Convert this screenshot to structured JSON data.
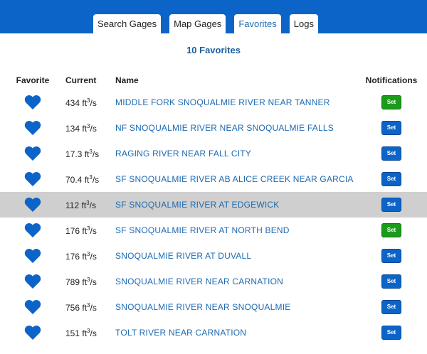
{
  "tabs": [
    {
      "label": "Search Gages"
    },
    {
      "label": "Map Gages"
    },
    {
      "label": "Favorites"
    },
    {
      "label": "Logs"
    }
  ],
  "active_tab": "Favorites",
  "favorites_count": "10 Favorites",
  "columns": {
    "favorite": "Favorite",
    "current": "Current",
    "name": "Name",
    "notifications": "Notifications"
  },
  "unit": {
    "base": "ft",
    "exp": "3",
    "suffix": "/s"
  },
  "colors": {
    "accent": "#0d64c8",
    "link": "#1d6ab2",
    "heart": "#0d64c8",
    "set_blue": "#0d64c8",
    "set_green": "#1c9a1c",
    "highlight_row": "#cfcfcf"
  },
  "rows": [
    {
      "flow": "434",
      "name": "MIDDLE FORK SNOQUALMIE RIVER NEAR TANNER",
      "set": "Set",
      "set_color": "green",
      "highlighted": false
    },
    {
      "flow": "134",
      "name": "NF SNOQUALMIE RIVER NEAR SNOQUALMIE FALLS",
      "set": "Set",
      "set_color": "blue",
      "highlighted": false
    },
    {
      "flow": "17.3",
      "name": "RAGING RIVER NEAR FALL CITY",
      "set": "Set",
      "set_color": "blue",
      "highlighted": false
    },
    {
      "flow": "70.4",
      "name": "SF SNOQUALMIE RIVER AB ALICE CREEK NEAR GARCIA",
      "set": "Set",
      "set_color": "blue",
      "highlighted": false
    },
    {
      "flow": "112",
      "name": "SF SNOQUALMIE RIVER AT EDGEWICK",
      "set": "Set",
      "set_color": "blue",
      "highlighted": true
    },
    {
      "flow": "176",
      "name": "SF SNOQUALMIE RIVER AT NORTH BEND",
      "set": "Set",
      "set_color": "green",
      "highlighted": false
    },
    {
      "flow": "176",
      "name": "SNOQUALMIE RIVER AT DUVALL",
      "set": "Set",
      "set_color": "blue",
      "highlighted": false
    },
    {
      "flow": "789",
      "name": "SNOQUALMIE RIVER NEAR CARNATION",
      "set": "Set",
      "set_color": "blue",
      "highlighted": false
    },
    {
      "flow": "756",
      "name": "SNOQUALMIE RIVER NEAR SNOQUALMIE",
      "set": "Set",
      "set_color": "blue",
      "highlighted": false
    },
    {
      "flow": "151",
      "name": "TOLT RIVER NEAR CARNATION",
      "set": "Set",
      "set_color": "blue",
      "highlighted": false
    }
  ]
}
